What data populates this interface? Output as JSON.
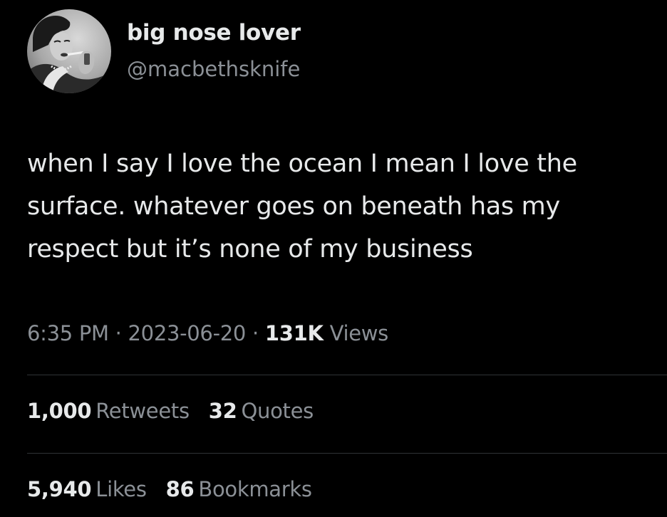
{
  "user": {
    "display_name": "big nose lover",
    "handle": "@macbethsknife"
  },
  "tweet": {
    "lines": [
      "when I say I love the ocean I mean I love the",
      "surface. whatever goes on beneath has my",
      "respect but it’s none of my business"
    ]
  },
  "meta": {
    "time": "6:35 PM",
    "separator": "·",
    "date": "2023-06-20",
    "views_count": "131K",
    "views_label": "Views"
  },
  "stats_row1": {
    "retweets_count": "1,000",
    "retweets_label": "Retweets",
    "quotes_count": "32",
    "quotes_label": "Quotes"
  },
  "stats_row2": {
    "likes_count": "5,940",
    "likes_label": "Likes",
    "bookmarks_count": "86",
    "bookmarks_label": "Bookmarks"
  },
  "colors": {
    "background": "#000000",
    "primary_text": "#e7e9ea",
    "secondary_text": "#8b9096",
    "divider": "#2f3336"
  }
}
